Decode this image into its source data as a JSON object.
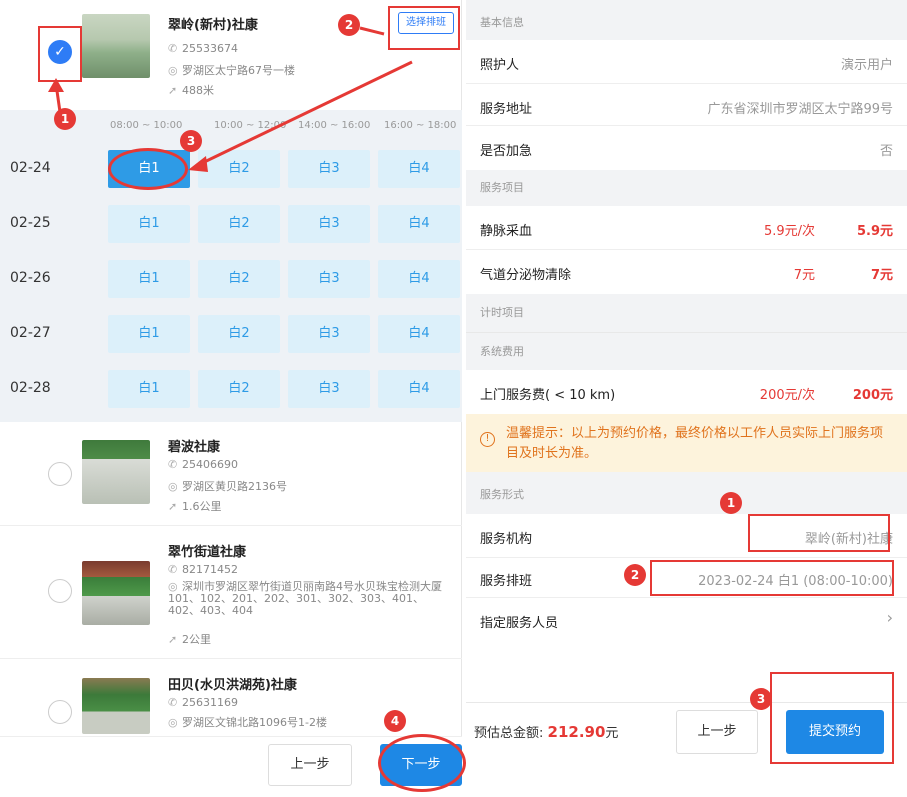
{
  "stores": [
    {
      "name": "翠岭(新村)社康",
      "phone": "25533674",
      "address": "罗湖区太宁路67号一楼",
      "distance": "488米",
      "checked": true
    },
    {
      "name": "碧波社康",
      "phone": "25406690",
      "address": "罗湖区黄贝路2136号",
      "distance": "1.6公里",
      "checked": false
    },
    {
      "name": "翠竹街道社康",
      "phone": "82171452",
      "address": "深圳市罗湖区翠竹街道贝丽南路4号水贝珠宝检测大厦101、102、201、202、301、302、303、401、402、403、404",
      "distance": "2公里",
      "checked": false
    },
    {
      "name": "田贝(水贝洪湖苑)社康",
      "phone": "25631169",
      "address": "罗湖区文锦北路1096号1-2楼",
      "distance": "",
      "checked": false
    }
  ],
  "select_schedule_button": "选择排班",
  "time_slots": [
    "08:00 ~ 10:00",
    "10:00 ~ 12:00",
    "14:00 ~ 16:00",
    "16:00 ~ 18:00"
  ],
  "schedule": [
    {
      "date": "02-24",
      "cells": [
        "白1",
        "白2",
        "白3",
        "白4"
      ]
    },
    {
      "date": "02-25",
      "cells": [
        "白1",
        "白2",
        "白3",
        "白4"
      ]
    },
    {
      "date": "02-26",
      "cells": [
        "白1",
        "白2",
        "白3",
        "白4"
      ]
    },
    {
      "date": "02-27",
      "cells": [
        "白1",
        "白2",
        "白3",
        "白4"
      ]
    },
    {
      "date": "02-28",
      "cells": [
        "白1",
        "白2",
        "白3",
        "白4"
      ]
    }
  ],
  "left_buttons": {
    "prev": "上一步",
    "next": "下一步"
  },
  "right": {
    "sec_basic": "基本信息",
    "caretaker_label": "照护人",
    "caretaker_value": "演示用户",
    "address_label": "服务地址",
    "address_value": "广东省深圳市罗湖区太宁路99号",
    "urgent_label": "是否加急",
    "urgent_value": "否",
    "sec_items": "服务项目",
    "items": [
      {
        "name": "静脉采血",
        "price": "5.9元/次",
        "total": "5.9元"
      },
      {
        "name": "气道分泌物清除",
        "price": "7元",
        "total": "7元"
      }
    ],
    "sec_timed": "计时项目",
    "sec_system": "系统费用",
    "visit_fee_label": "上门服务费( < 10 km)",
    "visit_fee_price": "200元/次",
    "visit_fee_total": "200元",
    "warning": "温馨提示：以上为预约价格，最终价格以工作人员实际上门服务项目及时长为准。",
    "sec_form": "服务形式",
    "org_label": "服务机构",
    "org_value": "翠岭(新村)社康",
    "sched_label": "服务排班",
    "sched_value": "2023-02-24 白1 (08:00-10:00)",
    "staff_label": "指定服务人员",
    "staff_arrow": "›",
    "total_label": "预估总金额:",
    "total_amount": "212.90",
    "total_unit": "元",
    "prev": "上一步",
    "submit": "提交预约"
  },
  "badges": {
    "b1": "1",
    "b2": "2",
    "b3": "3",
    "b4": "4"
  },
  "accent": "#2e9be6",
  "annotation_color": "#e53935"
}
